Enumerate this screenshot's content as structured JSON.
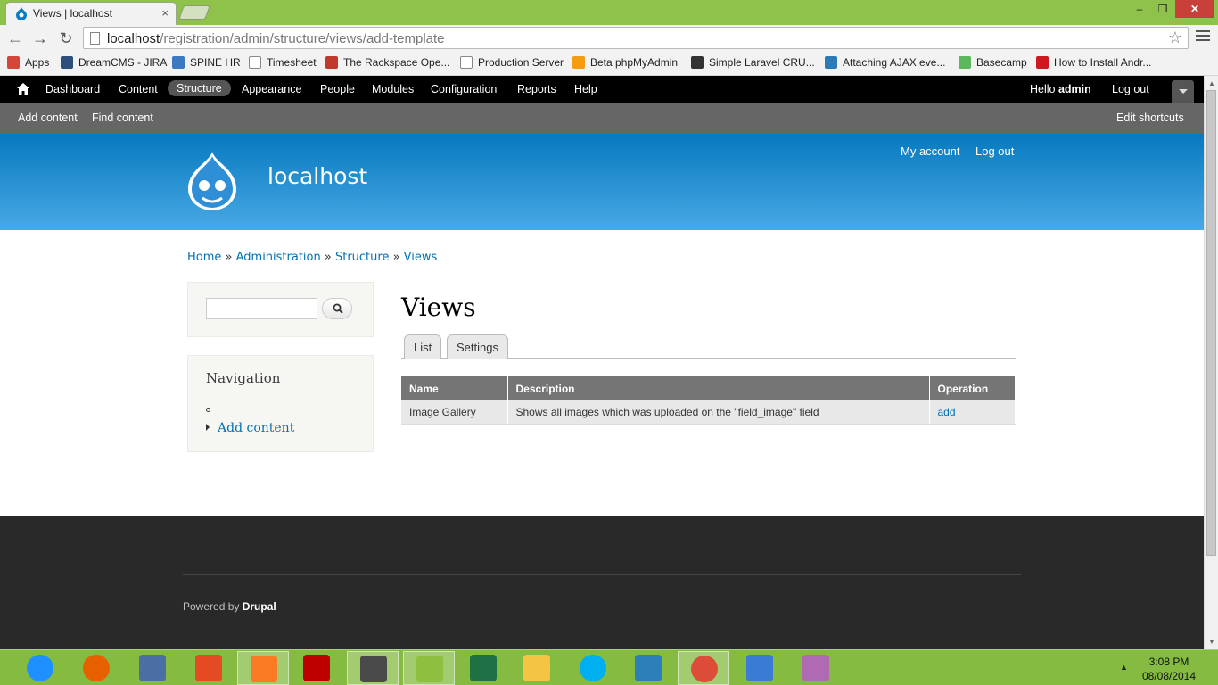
{
  "browser": {
    "tab_title": "Views | localhost",
    "tab_close": "×",
    "url_host": "localhost",
    "url_path": "/registration/admin/structure/views/add-template",
    "win_min": "–",
    "win_max": "❐",
    "win_close": "✕",
    "back": "←",
    "forward": "→",
    "reload": "↻",
    "star": "☆"
  },
  "bookmarks": [
    {
      "label": "Apps",
      "color": "#d44638"
    },
    {
      "label": "DreamCMS - JIRA",
      "color": "#2d4f7c"
    },
    {
      "label": "SPINE HR",
      "color": "#3d78c3"
    },
    {
      "label": "Timesheet",
      "color": "#ffffff"
    },
    {
      "label": "The Rackspace Ope...",
      "color": "#c0392b"
    },
    {
      "label": "Production Server",
      "color": "#ffffff"
    },
    {
      "label": "Beta phpMyAdmin",
      "color": "#f39c12"
    },
    {
      "label": "Simple Laravel CRU...",
      "color": "#333333"
    },
    {
      "label": "Attaching AJAX eve...",
      "color": "#2a7ab8"
    },
    {
      "label": "Basecamp",
      "color": "#5cb85c"
    },
    {
      "label": "How to Install Andr...",
      "color": "#cc181e"
    }
  ],
  "admin_toolbar": {
    "items": [
      "Dashboard",
      "Content",
      "Structure",
      "Appearance",
      "People",
      "Modules",
      "Configuration",
      "Reports",
      "Help"
    ],
    "active": "Structure",
    "hello": "Hello ",
    "user": "admin",
    "logout": "Log out"
  },
  "shortcuts": {
    "add_content": "Add content",
    "find_content": "Find content",
    "edit_shortcuts": "Edit shortcuts"
  },
  "header": {
    "site_name": "localhost",
    "my_account": "My account",
    "log_out": "Log out"
  },
  "breadcrumb": {
    "home": "Home",
    "administration": "Administration",
    "structure": "Structure",
    "views": "Views",
    "separator": " » "
  },
  "sidebar": {
    "nav_title": "Navigation",
    "nav_add": "Add content"
  },
  "main": {
    "title": "Views",
    "tabs": [
      "List",
      "Settings"
    ],
    "table": {
      "headers": [
        "Name",
        "Description",
        "Operation"
      ],
      "rows": [
        {
          "name": "Image Gallery",
          "description": "Shows all images which was uploaded on the \"field_image\" field",
          "operation": "add"
        }
      ]
    }
  },
  "footer": {
    "powered_by": "Powered by ",
    "drupal": "Drupal"
  },
  "taskbar": {
    "apps": [
      {
        "name": "internet-explorer",
        "color": "#1e90ff"
      },
      {
        "name": "firefox",
        "color": "#e66000"
      },
      {
        "name": "network",
        "color": "#4a6fa5"
      },
      {
        "name": "git",
        "color": "#e44b23"
      },
      {
        "name": "xampp",
        "color": "#fb7a24"
      },
      {
        "name": "filezilla",
        "color": "#bf0000"
      },
      {
        "name": "sublime-text",
        "color": "#4a4a4a"
      },
      {
        "name": "notepad-plus",
        "color": "#8fbf3f"
      },
      {
        "name": "excel",
        "color": "#1e7145"
      },
      {
        "name": "file-explorer",
        "color": "#f4c542"
      },
      {
        "name": "skype",
        "color": "#00aff0"
      },
      {
        "name": "settings",
        "color": "#2c7fb8"
      },
      {
        "name": "chrome",
        "color": "#dd4b39"
      },
      {
        "name": "remote-desktop",
        "color": "#3a7bd5"
      },
      {
        "name": "paint",
        "color": "#b06ab3"
      }
    ],
    "time": "3:08 PM",
    "date": "08/08/2014",
    "tray_arrow": "▲"
  }
}
